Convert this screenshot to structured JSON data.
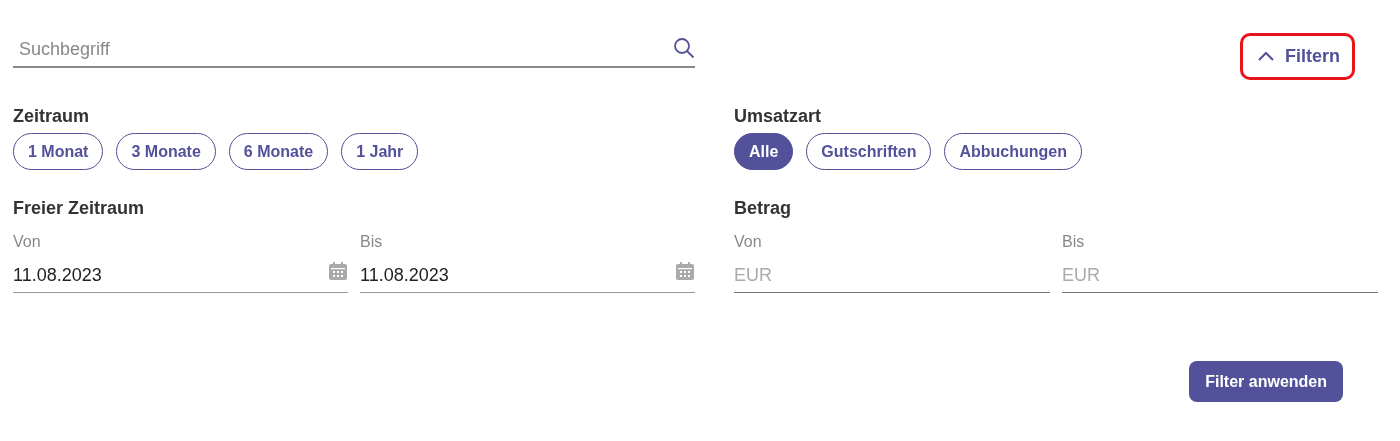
{
  "search": {
    "placeholder": "Suchbegriff"
  },
  "filter_toggle": {
    "label": "Filtern",
    "expanded": true,
    "highlighted": true
  },
  "zeitraum": {
    "title": "Zeitraum",
    "options": [
      {
        "label": "1 Monat",
        "selected": false
      },
      {
        "label": "3 Monate",
        "selected": false
      },
      {
        "label": "6 Monate",
        "selected": false
      },
      {
        "label": "1 Jahr",
        "selected": false
      }
    ]
  },
  "umsatzart": {
    "title": "Umsatzart",
    "options": [
      {
        "label": "Alle",
        "selected": true
      },
      {
        "label": "Gutschriften",
        "selected": false
      },
      {
        "label": "Abbuchungen",
        "selected": false
      }
    ]
  },
  "freier_zeitraum": {
    "title": "Freier Zeitraum",
    "fields": [
      {
        "label": "Von",
        "value": "11.08.2023"
      },
      {
        "label": "Bis",
        "value": "11.08.2023"
      }
    ]
  },
  "betrag": {
    "title": "Betrag",
    "fields": [
      {
        "label": "Von",
        "placeholder": "EUR"
      },
      {
        "label": "Bis",
        "placeholder": "EUR"
      }
    ]
  },
  "apply_button": {
    "label": "Filter anwenden"
  }
}
